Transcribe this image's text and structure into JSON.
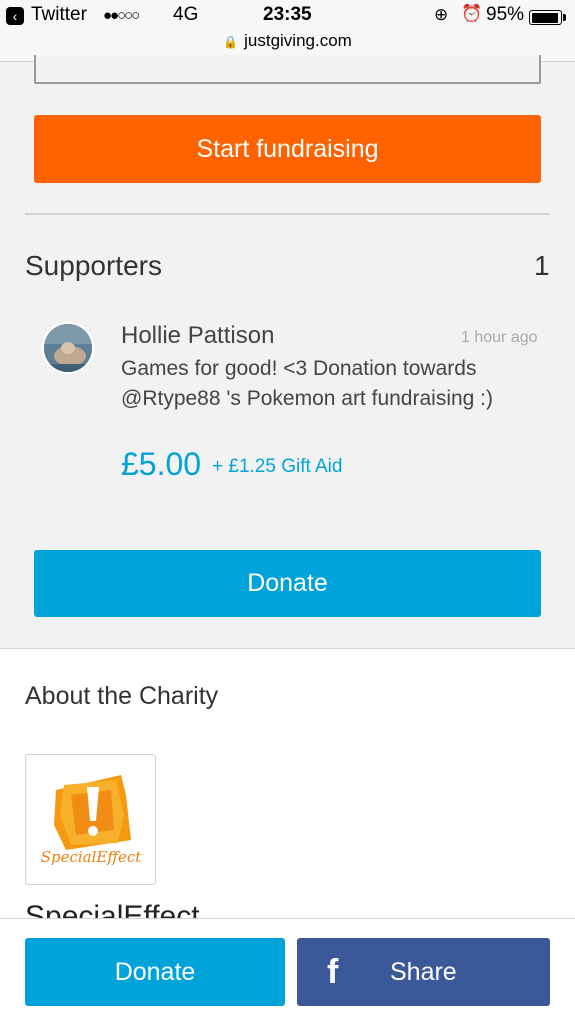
{
  "status_bar": {
    "back_app": "Twitter",
    "signal": "●●○○○",
    "network": "4G",
    "time": "23:35",
    "battery": "95%",
    "url": "justgiving.com"
  },
  "fundraise_button": "Start fundraising",
  "supporters": {
    "title": "Supporters",
    "count": "1",
    "items": [
      {
        "name": "Hollie Pattison",
        "time": "1 hour ago",
        "message": "Games for good! <3 Donation towards @Rtype88 's Pokemon art fundraising :)",
        "amount": "£5.00",
        "gift_aid": "+ £1.25 Gift Aid"
      }
    ]
  },
  "donate_button": "Donate",
  "about": {
    "title": "About the Charity",
    "charity_name": "SpecialEffect",
    "logo_text": "SpecialEffect"
  },
  "bottom_bar": {
    "donate_label": "Donate",
    "share_label": "Share"
  },
  "colors": {
    "orange": "#ff6200",
    "blue": "#00a3d9",
    "facebook": "#3b5998"
  }
}
